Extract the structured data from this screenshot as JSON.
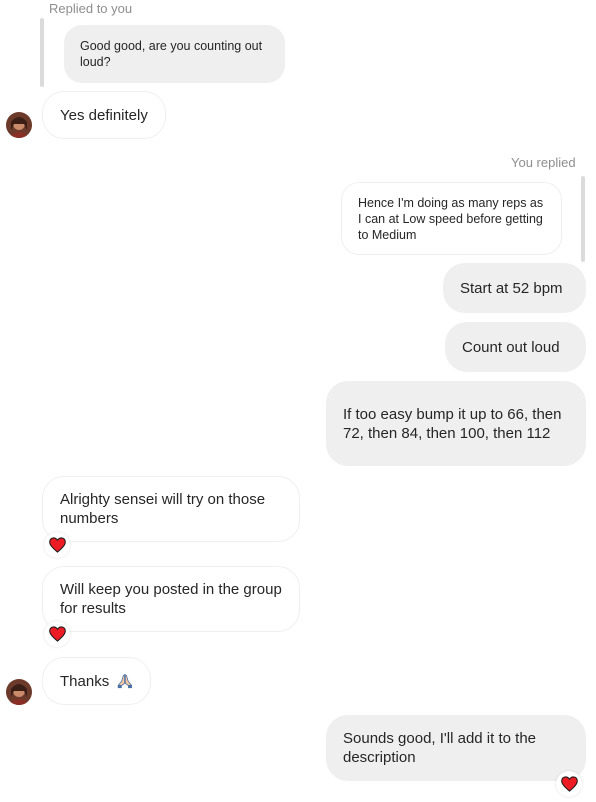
{
  "thread": {
    "replied_to_you_label": "Replied to you",
    "you_replied_label": "You replied",
    "quoted_incoming": "Good good, are you counting out loud?",
    "quoted_outgoing": "Hence I'm doing as many reps as I can at Low speed before getting to Medium",
    "messages": [
      {
        "side": "in",
        "text": "Yes definitely"
      },
      {
        "side": "out",
        "text": "Start at 52 bpm"
      },
      {
        "side": "out",
        "text": "Count out loud"
      },
      {
        "side": "out",
        "text": "If too easy bump it up to 66, then 72, then 84, then 100, then 112"
      },
      {
        "side": "in",
        "text": "Alrighty sensei will try on those numbers",
        "reaction": "heart"
      },
      {
        "side": "in",
        "text": "Will keep you posted in the group for results",
        "reaction": "heart"
      },
      {
        "side": "in",
        "text": "Thanks",
        "emoji": "pray-icon"
      },
      {
        "side": "out",
        "text": "Sounds good, I'll add it to the description",
        "reaction": "heart"
      }
    ]
  },
  "colors": {
    "incoming_bg": "#ffffff",
    "outgoing_bg": "#efefef",
    "heart": "#ed1c24",
    "meta_text": "#8e8e8e"
  }
}
